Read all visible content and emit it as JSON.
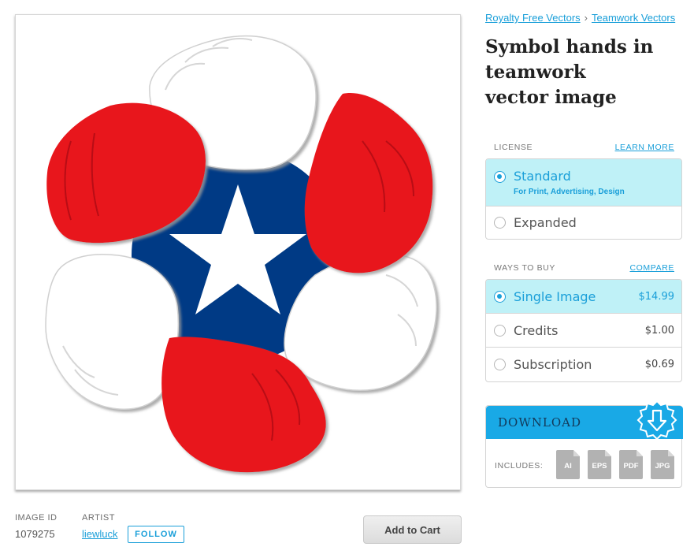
{
  "breadcrumb": {
    "items": [
      "Royalty Free Vectors",
      "Teamwork Vectors"
    ],
    "separator": "›"
  },
  "title": {
    "lines": [
      "Symbol hands in",
      "teamwork",
      "vector image"
    ]
  },
  "license": {
    "label": "LICENSE",
    "learn_more": "LEARN MORE",
    "options": [
      {
        "name": "Standard",
        "sub": "For Print, Advertising, Design",
        "selected": true
      },
      {
        "name": "Expanded",
        "selected": false
      }
    ]
  },
  "ways_to_buy": {
    "label": "WAYS TO BUY",
    "compare": "COMPARE",
    "options": [
      {
        "name": "Single Image",
        "price": "$14.99",
        "selected": true
      },
      {
        "name": "Credits",
        "price": "$1.00",
        "selected": false
      },
      {
        "name": "Subscription",
        "price": "$0.69",
        "selected": false
      }
    ]
  },
  "download": {
    "label": "DOWNLOAD",
    "includes_label": "INCLUDES:",
    "formats": [
      "AI",
      "EPS",
      "PDF",
      "JPG"
    ]
  },
  "image_meta": {
    "id_label": "IMAGE ID",
    "id_value": "1079275",
    "artist_label": "ARTIST",
    "artist_name": "liewluck",
    "follow_label": "FOLLOW"
  },
  "cart": {
    "label": "Add to Cart"
  },
  "artwork": {
    "icon": "hands-star-emblem",
    "colors": {
      "red": "#e8151b",
      "blue": "#003a85",
      "white": "#ffffff",
      "shade": "#c9c9c9"
    }
  },
  "colors": {
    "accent": "#1a9fd9",
    "selected_bg": "#bff1f7",
    "download_bg": "#19a9e6"
  }
}
